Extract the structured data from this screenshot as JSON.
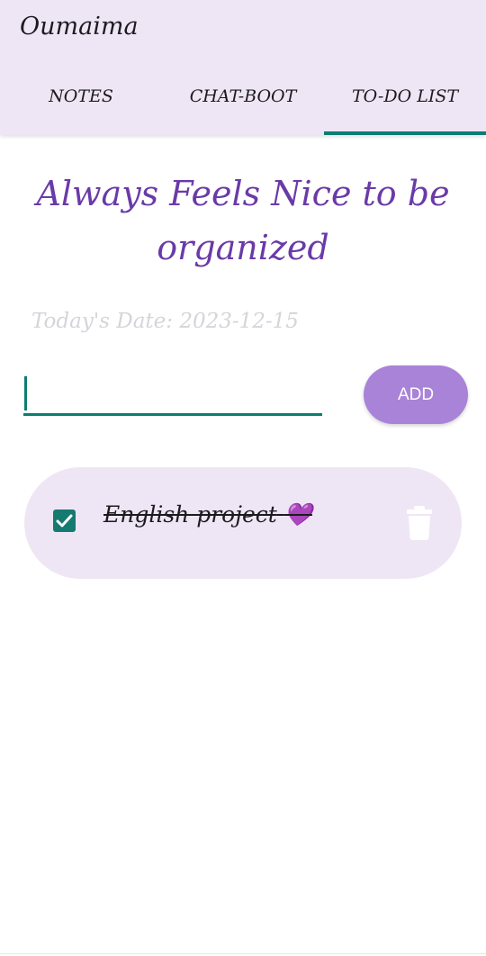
{
  "app": {
    "title": "Oumaima"
  },
  "tabs": [
    {
      "label": "NOTES",
      "selected": false
    },
    {
      "label": "CHAT-BOOT",
      "selected": false
    },
    {
      "label": "TO-DO LIST",
      "selected": true
    }
  ],
  "main": {
    "headline_line1": "Always Feels Nice to be",
    "headline_line2": "organized",
    "date_text": "Today's Date: 2023-12-15",
    "task_input": {
      "value": "",
      "placeholder": ""
    },
    "add_label": "ADD",
    "todos": [
      {
        "text": "English project",
        "emoji": "💜",
        "checked": true,
        "struck_through": true
      }
    ]
  },
  "colors": {
    "accent": "#0b7d71",
    "headline": "#6a3aa8",
    "add_button": "#a883d8",
    "surface": "#efe6f5"
  },
  "icons": {
    "check": "check-icon",
    "delete": "trash-icon"
  }
}
